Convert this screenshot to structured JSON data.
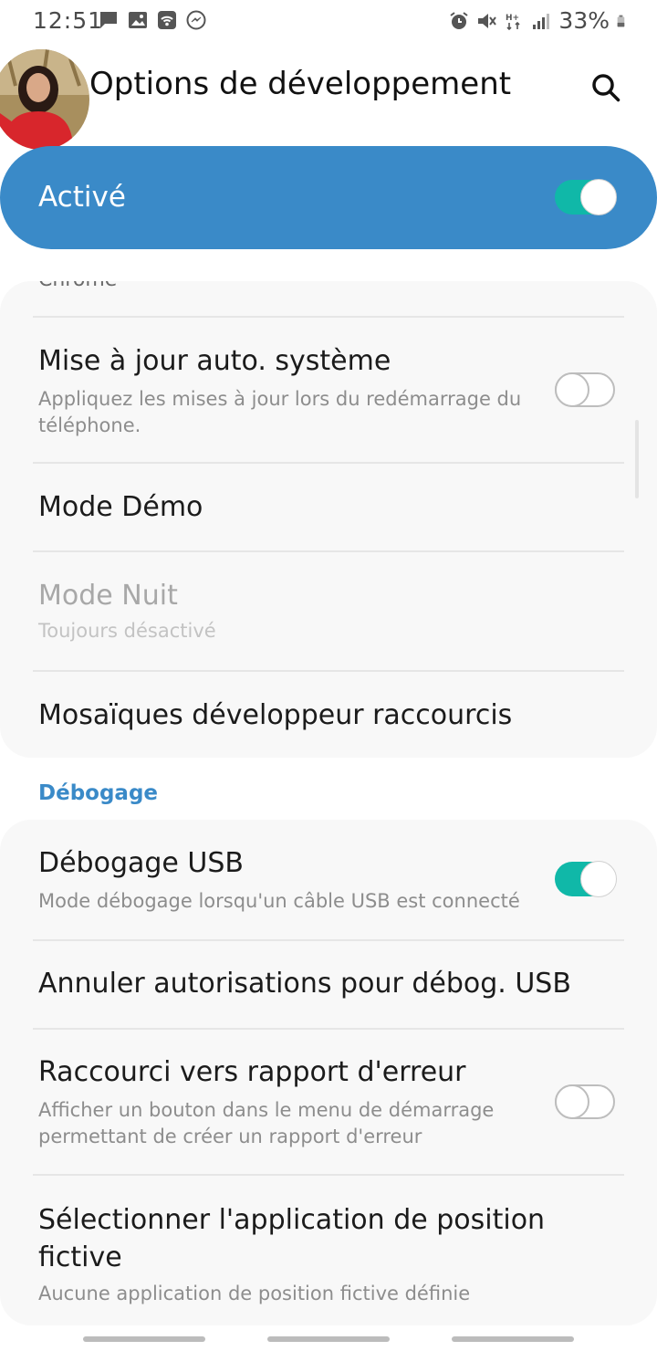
{
  "status_bar": {
    "time": "12:51",
    "battery": "33%",
    "left_icons": [
      "message-icon",
      "image-icon",
      "wifi-calling-icon",
      "messenger-icon"
    ],
    "right_icons": [
      "alarm-icon",
      "mute-icon",
      "data-hplus-icon",
      "signal-icon",
      "battery-icon"
    ]
  },
  "header": {
    "title": "Options de développement"
  },
  "master_switch": {
    "label": "Activé",
    "state": "on",
    "color": "#3a8ac8"
  },
  "card1": {
    "partial_text": "Chrome",
    "items": [
      {
        "title": "Mise à jour auto. système",
        "subtitle": "Appliquez les mises à jour lors du redémarrage du téléphone.",
        "toggle": "off"
      },
      {
        "title": "Mode Démo"
      },
      {
        "title": "Mode Nuit",
        "subtitle": "Toujours désactivé",
        "disabled": true
      },
      {
        "title": "Mosaïques développeur raccourcis"
      }
    ]
  },
  "debug_section": {
    "header": "Débogage",
    "items": [
      {
        "title": "Débogage USB",
        "subtitle": "Mode débogage lorsqu'un câble USB est connecté",
        "toggle": "on"
      },
      {
        "title": "Annuler autorisations pour débog. USB"
      },
      {
        "title": "Raccourci vers rapport d'erreur",
        "subtitle": "Afficher un bouton dans le menu de démarrage permettant de créer un rapport d'erreur",
        "toggle": "off"
      },
      {
        "title": "Sélectionner l'application de position fictive",
        "subtitle": "Aucune application de position fictive définie"
      }
    ]
  },
  "colors": {
    "accent": "#3a8ac8",
    "toggle_on": "#10b8a8",
    "card_bg": "#f8f8f8"
  }
}
